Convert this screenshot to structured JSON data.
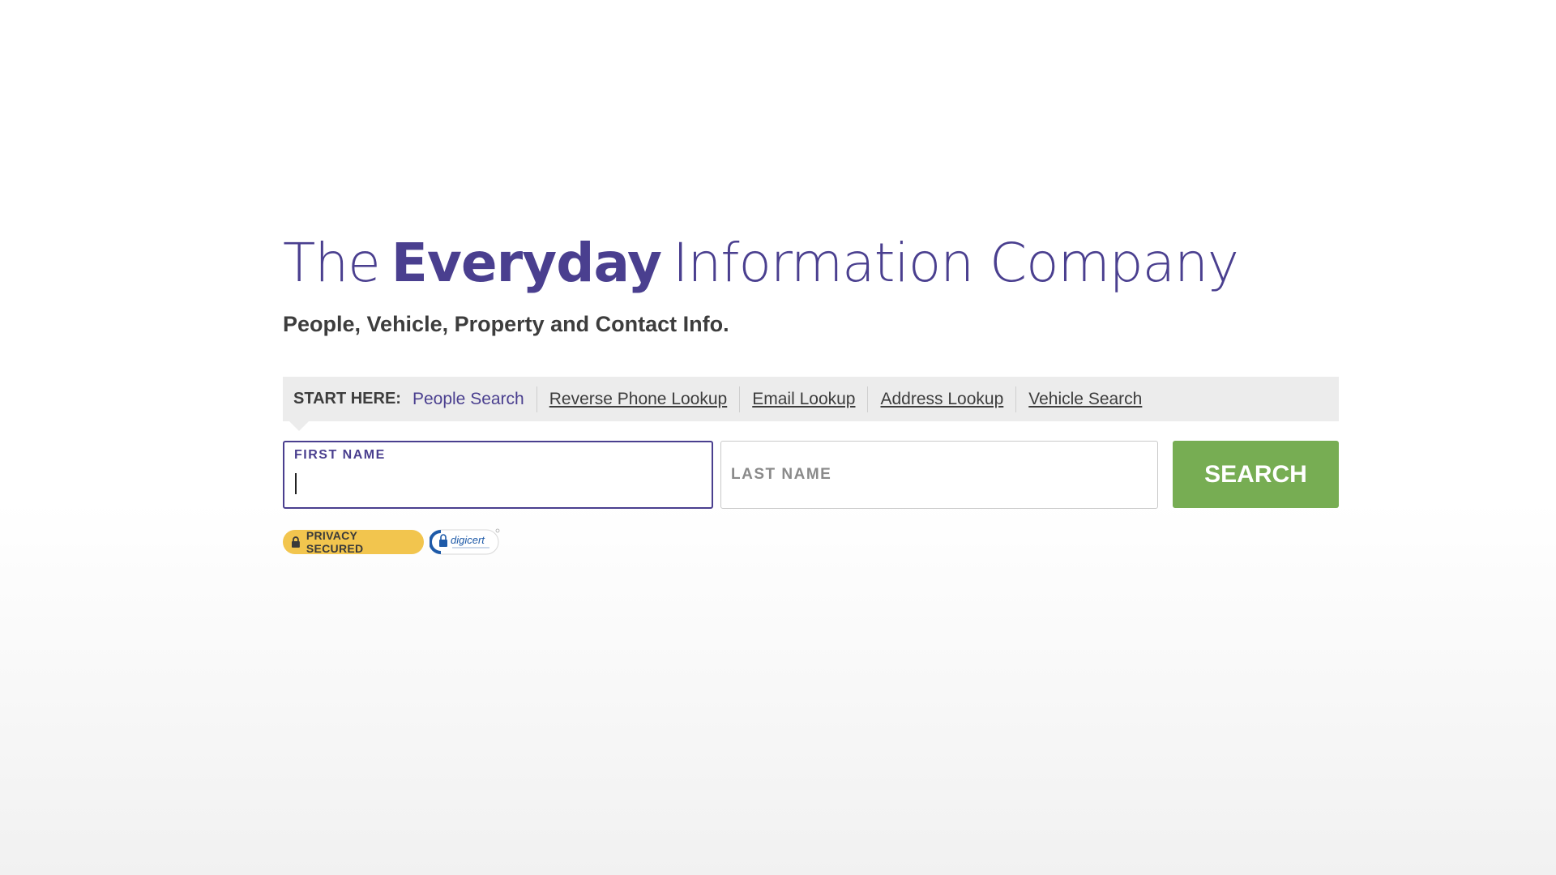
{
  "hero": {
    "headline_pre": "The",
    "headline_bold": "Everyday",
    "headline_post": "Information Company",
    "subhead": "People, Vehicle, Property and Contact Info."
  },
  "tabs": {
    "start_label": "START HERE:",
    "items": [
      {
        "label": "People Search",
        "active": true
      },
      {
        "label": "Reverse Phone Lookup",
        "active": false
      },
      {
        "label": "Email Lookup",
        "active": false
      },
      {
        "label": "Address Lookup",
        "active": false
      },
      {
        "label": "Vehicle Search",
        "active": false
      }
    ]
  },
  "form": {
    "first_name_label": "FIRST NAME",
    "first_name_value": "",
    "last_name_placeholder": "LAST NAME",
    "last_name_value": "",
    "search_label": "SEARCH"
  },
  "badges": {
    "privacy_label": "PRIVACY SECURED",
    "privacy_icon": "lock-icon",
    "digicert_label": "digicert",
    "digicert_icon": "digicert-seal-icon"
  },
  "colors": {
    "brand_purple": "#4a3f8f",
    "search_green": "#77ad53",
    "privacy_yellow": "#f2c54e",
    "digicert_blue": "#1e5aa8"
  }
}
